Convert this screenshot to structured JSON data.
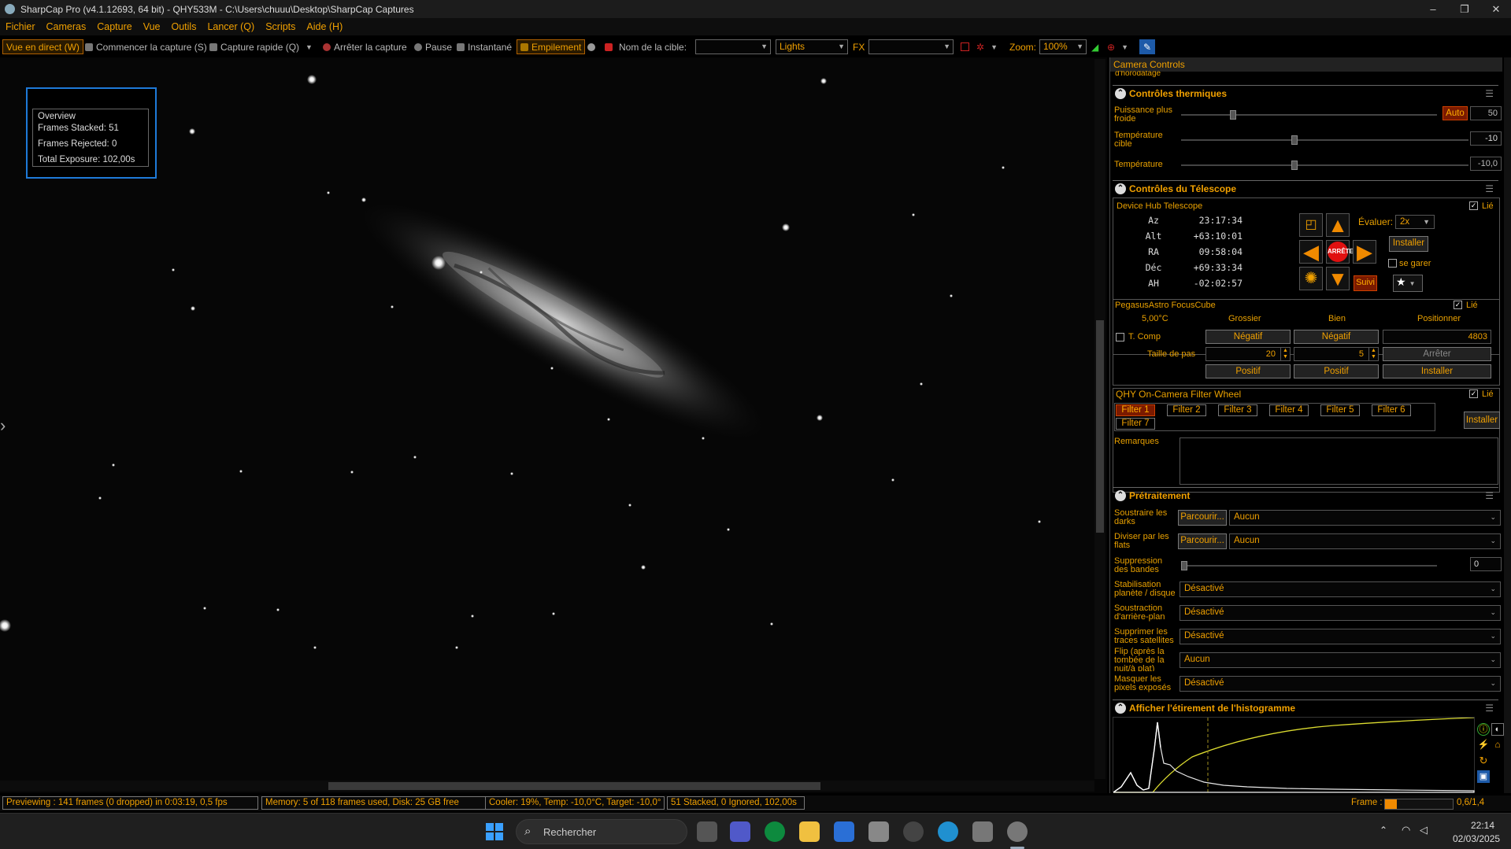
{
  "window": {
    "title": "SharpCap Pro (v4.1.12693, 64 bit) - QHY533M - C:\\Users\\chuuu\\Desktop\\SharpCap Captures",
    "minimize": "–",
    "maximize": "❐",
    "close": "✕"
  },
  "menu": [
    "Fichier",
    "Cameras",
    "Capture",
    "Vue",
    "Outils",
    "Lancer (Q)",
    "Scripts",
    "Aide (H)"
  ],
  "toolbar": {
    "live_view": "Vue en direct (W)",
    "start_capture": "Commencer la capture (S)",
    "quick_capture": "Capture rapide (Q)",
    "stop_capture": "Arrêter la capture",
    "pause": "Pause",
    "snapshot": "Instantané",
    "stacking": "Empilement",
    "target_label": "Nom de la cible:",
    "target_value": "",
    "frame_type": "Lights",
    "fx_label": "FX",
    "fx_value": "",
    "zoom_label": "Zoom:",
    "zoom_value": "100%"
  },
  "overview": {
    "title": "Overview",
    "stacked": "Frames Stacked:  51",
    "rejected": "Frames Rejected: 0",
    "exposure": "Total Exposure:   102,00s"
  },
  "panel": {
    "title": "Camera Controls",
    "cut_label": "d'horodatage",
    "thermal": {
      "title": "Contrôles thermiques",
      "power_label": "Puissance plus froide",
      "power_auto": "Auto",
      "power_value": "50",
      "target_temp_label": "Température cible",
      "target_temp_value": "-10",
      "temp_label": "Température",
      "temp_value": "-10,0"
    },
    "telescope": {
      "title": "Contrôles du Télescope",
      "device": "Device Hub Telescope",
      "linked": "Lié",
      "coords": [
        {
          "k": "Az",
          "v": "23:17:34"
        },
        {
          "k": "Alt",
          "v": "+63:10:01"
        },
        {
          "k": "RA",
          "v": "09:58:04"
        },
        {
          "k": "Déc",
          "v": "+69:33:34"
        },
        {
          "k": "AH",
          "v": "-02:02:57"
        }
      ],
      "stop": "ARRÊTE",
      "rate_label": "Évaluer:",
      "rate_value": "2x",
      "install": "Installer",
      "park": "se garer",
      "track": "Suivi"
    },
    "focuser": {
      "device": "PegasusAstro FocusCube",
      "linked": "Lié",
      "temp": "5,00°C",
      "coarse": "Grossier",
      "fine": "Bien",
      "position": "Positionner",
      "tcomp": "T. Comp",
      "negative": "Négatif",
      "position_value": "4803",
      "step_label": "Taille de pas",
      "coarse_step": "20",
      "fine_step": "5",
      "stop": "Arrêter",
      "positive": "Positif",
      "install": "Installer"
    },
    "filterwheel": {
      "device": "QHY On-Camera Filter Wheel",
      "linked": "Lié",
      "filters": [
        "Filter 1",
        "Filter 2",
        "Filter 3",
        "Filter 4",
        "Filter 5",
        "Filter 6",
        "Filter 7"
      ],
      "install": "Installer"
    },
    "notes_label": "Remarques",
    "preprocessing": {
      "title": "Prétraitement",
      "dark_label": "Soustraire les darks",
      "flat_label": "Diviser par les flats",
      "browse": "Parcourir...",
      "none": "Aucun",
      "banding_label": "Suppression des bandes",
      "banding_value": "0",
      "stab_label": "Stabilisation planète / disque",
      "bg_label": "Soustraction d'arrière-plan",
      "sat_label": "Supprimer les traces satellites",
      "flip_label": "Flip (après la tombée de la nuit/à plat)",
      "mask_label": "Masquer les pixels exposés",
      "disabled": "Désactivé"
    },
    "histogram": {
      "title": "Afficher l'étirement de l'histogramme"
    }
  },
  "status": {
    "preview": "Previewing : 141 frames (0 dropped) in 0:03:19, 0,5 fps",
    "memory": "Memory: 5 of 118 frames used, Disk: 25 GB free",
    "cooler": "Cooler: 19%, Temp: -10,0°C, Target: -10,0°",
    "stack": "51 Stacked, 0 Ignored, 102,00s",
    "frame_label": "Frame :",
    "frame_value": "0,6/1,4"
  },
  "taskbar": {
    "search": "Rechercher",
    "time": "22:14",
    "date": "02/03/2025"
  },
  "colors": {
    "accent": "#f0a000",
    "panel_bg": "#000000",
    "highlight_red": "#7a1a00"
  }
}
